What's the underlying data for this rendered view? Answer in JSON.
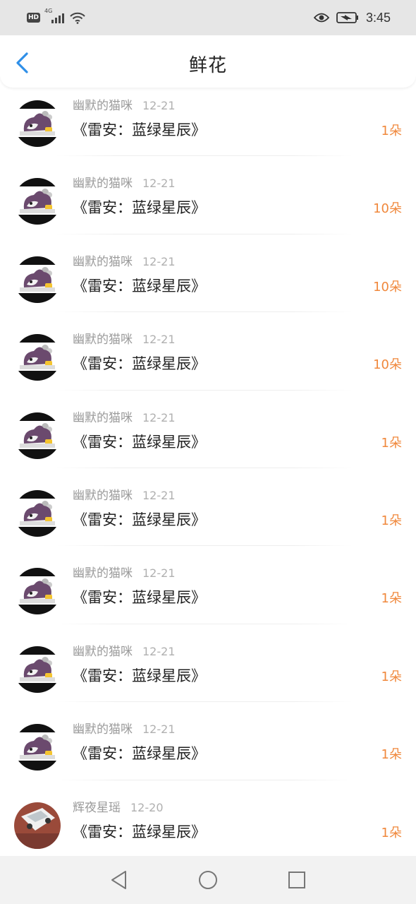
{
  "status_bar": {
    "hd_label": "HD",
    "network_label": "4G",
    "time": "3:45"
  },
  "header": {
    "title": "鲜花",
    "back_icon": "chevron-left-icon"
  },
  "colors": {
    "accent_blue": "#2f8fe8",
    "count_orange": "#f0883c"
  },
  "flowers": [
    {
      "user": "幽默的猫咪",
      "date": "12-21",
      "work": "《雷安：蓝绿星辰》",
      "count": "1朵",
      "avatar": "anime-cat-avatar"
    },
    {
      "user": "幽默的猫咪",
      "date": "12-21",
      "work": "《雷安：蓝绿星辰》",
      "count": "10朵",
      "avatar": "anime-cat-avatar"
    },
    {
      "user": "幽默的猫咪",
      "date": "12-21",
      "work": "《雷安：蓝绿星辰》",
      "count": "10朵",
      "avatar": "anime-cat-avatar"
    },
    {
      "user": "幽默的猫咪",
      "date": "12-21",
      "work": "《雷安：蓝绿星辰》",
      "count": "10朵",
      "avatar": "anime-cat-avatar"
    },
    {
      "user": "幽默的猫咪",
      "date": "12-21",
      "work": "《雷安：蓝绿星辰》",
      "count": "1朵",
      "avatar": "anime-cat-avatar"
    },
    {
      "user": "幽默的猫咪",
      "date": "12-21",
      "work": "《雷安：蓝绿星辰》",
      "count": "1朵",
      "avatar": "anime-cat-avatar"
    },
    {
      "user": "幽默的猫咪",
      "date": "12-21",
      "work": "《雷安：蓝绿星辰》",
      "count": "1朵",
      "avatar": "anime-cat-avatar"
    },
    {
      "user": "幽默的猫咪",
      "date": "12-21",
      "work": "《雷安：蓝绿星辰》",
      "count": "1朵",
      "avatar": "anime-cat-avatar"
    },
    {
      "user": "幽默的猫咪",
      "date": "12-21",
      "work": "《雷安：蓝绿星辰》",
      "count": "1朵",
      "avatar": "anime-cat-avatar"
    },
    {
      "user": "辉夜星瑶",
      "date": "12-20",
      "work": "《雷安：蓝绿星辰》",
      "count": "1朵",
      "avatar": "car-photo-avatar"
    }
  ],
  "nav": {
    "back_icon": "triangle-back-icon",
    "home_icon": "circle-home-icon",
    "recents_icon": "square-recents-icon"
  }
}
